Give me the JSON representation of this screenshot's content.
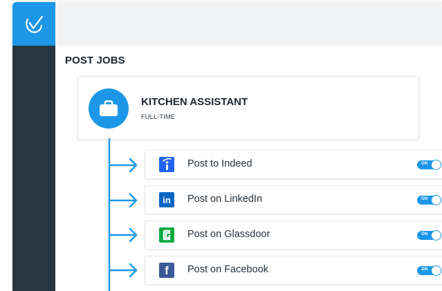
{
  "app": {
    "logo_icon": "checkmark-circle-logo",
    "accent_color": "#1c97e7"
  },
  "page": {
    "title": "POST JOBS"
  },
  "job": {
    "title": "KITCHEN ASSISTANT",
    "type": "FULL-TIME",
    "icon": "briefcase-icon"
  },
  "posting_options": [
    {
      "label": "Post to Indeed",
      "icon": "indeed-icon",
      "brand_color": "#2164f3",
      "toggle": "ON"
    },
    {
      "label": "Post on LinkedIn",
      "icon": "linkedin-icon",
      "brand_color": "#0a66c2",
      "toggle": "ON"
    },
    {
      "label": "Post on Glassdoor",
      "icon": "glassdoor-icon",
      "brand_color": "#0caa41",
      "toggle": "ON"
    },
    {
      "label": "Post on Facebook",
      "icon": "facebook-icon",
      "brand_color": "#3b5998",
      "toggle": "ON"
    }
  ]
}
